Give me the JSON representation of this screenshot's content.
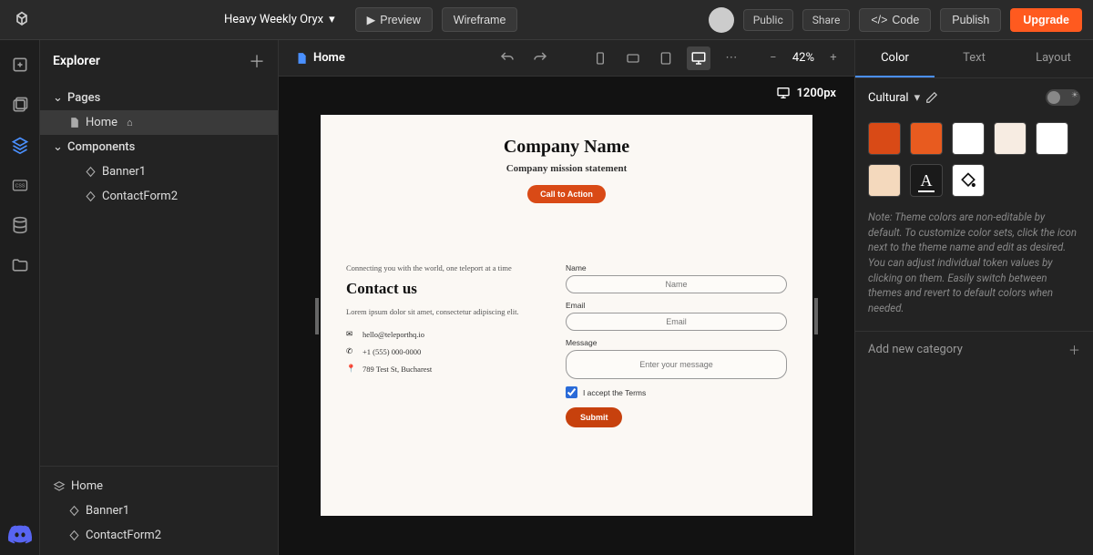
{
  "topbar": {
    "project_title": "Heavy Weekly Oryx",
    "preview_label": "Preview",
    "wireframe_label": "Wireframe",
    "public_label": "Public",
    "share_label": "Share",
    "code_label": "Code",
    "publish_label": "Publish",
    "upgrade_label": "Upgrade"
  },
  "explorer": {
    "title": "Explorer",
    "sections": {
      "pages": "Pages",
      "components": "Components"
    },
    "pages": [
      {
        "label": "Home",
        "is_home": true
      }
    ],
    "components": [
      {
        "label": "Banner1"
      },
      {
        "label": "ContactForm2"
      }
    ],
    "outline": {
      "root": "Home",
      "children": [
        {
          "label": "Banner1"
        },
        {
          "label": "ContactForm2"
        }
      ]
    }
  },
  "canvas": {
    "tab_label": "Home",
    "zoom": "42%",
    "width_label": "1200px"
  },
  "preview": {
    "banner": {
      "title": "Company Name",
      "subtitle": "Company mission statement",
      "cta": "Call to Action"
    },
    "contact": {
      "tagline": "Connecting you with the world, one teleport at a time",
      "heading": "Contact us",
      "desc": "Lorem ipsum dolor sit amet, consectetur adipiscing elit.",
      "email": "hello@teleporthq.io",
      "phone": "+1 (555) 000-0000",
      "address": "789 Test St, Bucharest",
      "labels": {
        "name": "Name",
        "email": "Email",
        "message": "Message"
      },
      "placeholders": {
        "name": "Name",
        "email": "Email",
        "message": "Enter your message"
      },
      "terms": "I accept the Terms",
      "submit": "Submit"
    }
  },
  "right": {
    "tabs": {
      "color": "Color",
      "text": "Text",
      "layout": "Layout"
    },
    "theme_name": "Cultural",
    "swatches": [
      "#d94a16",
      "#e85b1f",
      "#ffffff",
      "#f7ece2",
      "#ffffff",
      "#f4d9bd"
    ],
    "note": "Note: Theme colors are non-editable by default. To customize color sets, click the icon next to the theme name and edit as desired. You can adjust individual token values by clicking on them. Easily switch between themes and revert to default colors when needed.",
    "add_category": "Add new category"
  }
}
